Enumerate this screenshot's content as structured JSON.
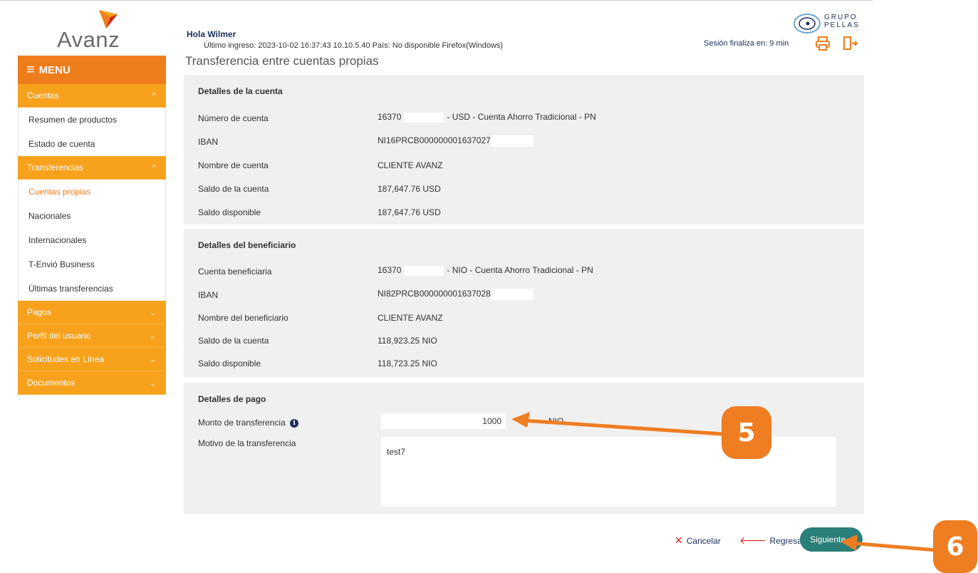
{
  "brand": {
    "logo_text": "Avanz",
    "group_line1": "GRUPO",
    "group_line2": "PELLAS"
  },
  "menu": {
    "title": "MENU"
  },
  "sidebar": {
    "sections": [
      {
        "label": "Cuentas",
        "items": [
          "Resumen de productos",
          "Estado de cuenta"
        ]
      },
      {
        "label": "Transferencias",
        "items": [
          "Cuentas propias",
          "Nacionales",
          "Internacionales",
          "T-Envió Business",
          "Últimas transferencias"
        ]
      },
      {
        "label": "Pagos"
      },
      {
        "label": "Perfil del usuario"
      },
      {
        "label": "Solicitudes en Línea"
      },
      {
        "label": "Documentos"
      }
    ]
  },
  "header": {
    "greeting": "Hola Wilmer",
    "last_login": "Último ingreso: 2023-10-02 16:37:43 10.10.5.40 País: No disponible Firefox(Windows)",
    "session": "Sesión finaliza en: 9 min"
  },
  "page": {
    "title": "Transferencia entre cuentas propias"
  },
  "account": {
    "title": "Detalles de la cuenta",
    "labels": [
      "Número de cuenta",
      "IBAN",
      "Nombre de cuenta",
      "Saldo de la cuenta",
      "Saldo disponible"
    ],
    "number_prefix": "16370",
    "number_suffix": "- USD - Cuenta Ahorro Tradicional - PN",
    "iban": "NI16PRCB000000001637027",
    "name": "CLIENTE AVANZ",
    "balance": "187,647.76 USD",
    "available": "187,647.76 USD"
  },
  "beneficiary": {
    "title": "Detalles del beneficiario",
    "labels": [
      "Cuenta beneficiaria",
      "IBAN",
      "Nombre del beneficiario",
      "Saldo de la cuenta",
      "Saldo disponible"
    ],
    "number_prefix": "16370",
    "number_suffix": "- NIO - Cuenta Ahorro Tradicional - PN",
    "iban": "NI82PRCB000000001637028",
    "name": "CLIENTE AVANZ",
    "balance": "118,923.25 NIO",
    "available": "118,723.25 NIO"
  },
  "payment": {
    "title": "Detalles de pago",
    "amount_label": "Monto de transferencia",
    "amount_value": "1000",
    "currency": "NIO",
    "reason_label": "Motivo de la transferencia",
    "reason_value": "test7"
  },
  "actions": {
    "cancel": "Cancelar",
    "back": "Regresar",
    "next": "Siguiente"
  },
  "annotations": {
    "step5": "5",
    "step6": "6"
  },
  "colors": {
    "accent_orange": "#ee7d1c",
    "menu_orange": "#f7a11c",
    "brand_navy": "#1d2f5b",
    "button_teal": "#2a7f78",
    "annotation_orange": "#ef7d22"
  }
}
